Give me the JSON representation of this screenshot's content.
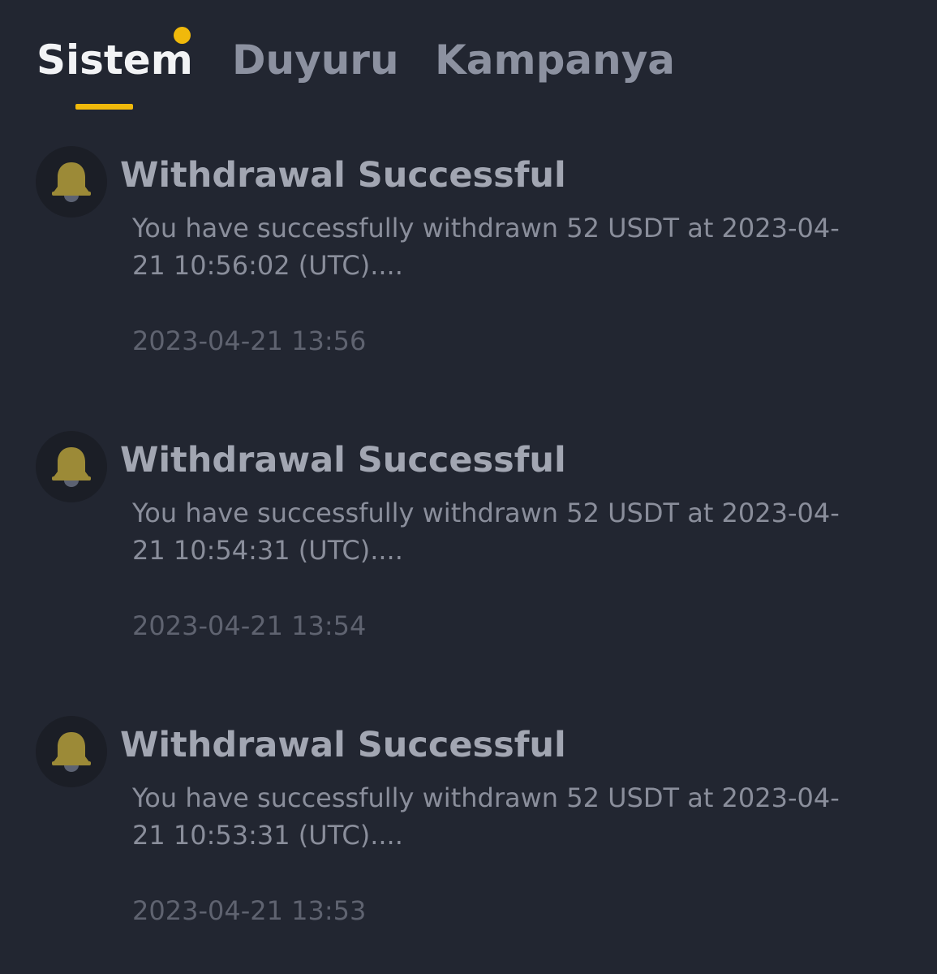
{
  "tabs": [
    {
      "label": "Sistem",
      "active": true,
      "has_dot": true
    },
    {
      "label": "Duyuru",
      "active": false
    },
    {
      "label": "Kampanya",
      "active": false
    }
  ],
  "colors": {
    "background": "#222631",
    "accent": "#f0b90b",
    "bell": "#9c8a37"
  },
  "notifications": [
    {
      "icon": "bell-icon",
      "title": "Withdrawal Successful",
      "body": "You have successfully withdrawn 52 USDT at 2023-04-21 10:56:02 (UTC)....",
      "time": "2023-04-21 13:56"
    },
    {
      "icon": "bell-icon",
      "title": "Withdrawal Successful",
      "body": "You have successfully withdrawn 52 USDT at 2023-04-21 10:54:31 (UTC)....",
      "time": "2023-04-21 13:54"
    },
    {
      "icon": "bell-icon",
      "title": "Withdrawal Successful",
      "body": "You have successfully withdrawn 52 USDT at 2023-04-21 10:53:31 (UTC)....",
      "time": "2023-04-21 13:53"
    }
  ]
}
